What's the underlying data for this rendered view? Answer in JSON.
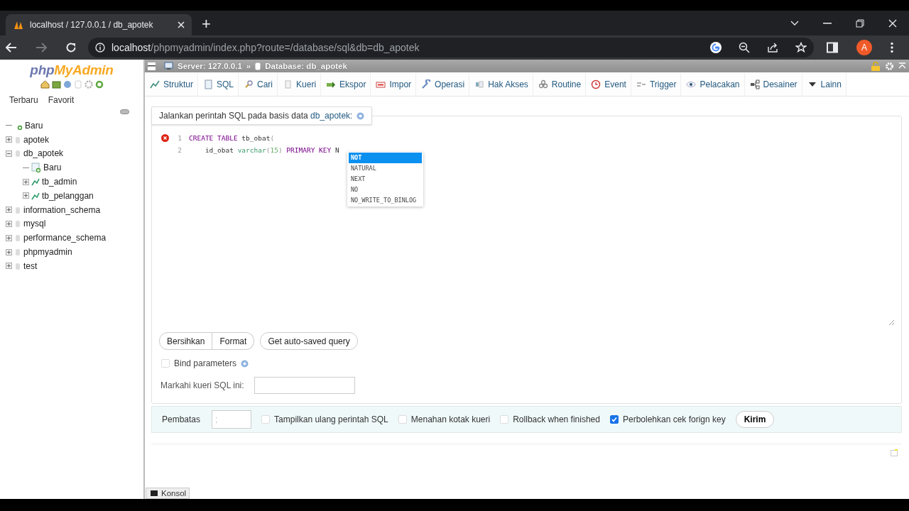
{
  "browser": {
    "tab_title": "localhost / 127.0.0.1 / db_apotek",
    "new_tab": "+",
    "url_host": "localhost",
    "url_path": "/phpmyadmin/index.php?route=/database/sql&db=db_apotek",
    "profile_initial": "A"
  },
  "sidebar": {
    "logo_php": "php",
    "logo_myadmin": "MyAdmin",
    "links": [
      "Terbaru",
      "Favorit"
    ],
    "tree": [
      {
        "label": "Baru",
        "kind": "new"
      },
      {
        "label": "apotek",
        "kind": "database",
        "expanded": false
      },
      {
        "label": "db_apotek",
        "kind": "database",
        "expanded": true,
        "children": [
          {
            "label": "Baru",
            "kind": "new-table"
          },
          {
            "label": "tb_admin",
            "kind": "table",
            "expanded": false
          },
          {
            "label": "tb_pelanggan",
            "kind": "table",
            "expanded": false
          }
        ]
      },
      {
        "label": "information_schema",
        "kind": "database",
        "expanded": false
      },
      {
        "label": "mysql",
        "kind": "database",
        "expanded": false
      },
      {
        "label": "performance_schema",
        "kind": "database",
        "expanded": false
      },
      {
        "label": "phpmyadmin",
        "kind": "database",
        "expanded": false
      },
      {
        "label": "test",
        "kind": "database",
        "expanded": false
      }
    ]
  },
  "breadcrumb": {
    "server": "Server: 127.0.0.1",
    "separator": "»",
    "database": "Database: db_apotek"
  },
  "tabs": [
    {
      "label": "Struktur",
      "selected": false
    },
    {
      "label": "SQL",
      "selected": true
    },
    {
      "label": "Cari",
      "selected": false
    },
    {
      "label": "Kueri",
      "selected": false
    },
    {
      "label": "Ekspor",
      "selected": false
    },
    {
      "label": "Impor",
      "selected": false
    },
    {
      "label": "Operasi",
      "selected": false
    },
    {
      "label": "Hak Akses",
      "selected": false
    },
    {
      "label": "Routine",
      "selected": false
    },
    {
      "label": "Event",
      "selected": false
    },
    {
      "label": "Trigger",
      "selected": false
    },
    {
      "label": "Pelacakan",
      "selected": false
    },
    {
      "label": "Desainer",
      "selected": false
    },
    {
      "label": "Lainn",
      "selected": false
    }
  ],
  "query_box": {
    "legend": "Jalankan perintah SQL pada basis data",
    "legend_link": "db_apotek:",
    "lines": [
      {
        "number": "1",
        "error": true,
        "tokens": [
          {
            "kind": "keyword",
            "text": "CREATE TABLE"
          },
          {
            "kind": "plain",
            "text": " tb_obat"
          },
          {
            "kind": "paren",
            "text": "("
          }
        ]
      },
      {
        "number": "2",
        "error": false,
        "tokens": [
          {
            "kind": "plain",
            "text": "    id_obat "
          },
          {
            "kind": "type",
            "text": "varchar"
          },
          {
            "kind": "paren",
            "text": "("
          },
          {
            "kind": "number",
            "text": "15"
          },
          {
            "kind": "paren",
            "text": ")"
          },
          {
            "kind": "keyword",
            "text": " PRIMARY KEY"
          },
          {
            "kind": "plain",
            "text": " N"
          }
        ]
      }
    ],
    "autocomplete": [
      {
        "label": "NOT",
        "selected": true
      },
      {
        "label": "NATURAL",
        "selected": false
      },
      {
        "label": "NEXT",
        "selected": false
      },
      {
        "label": "NO",
        "selected": false
      },
      {
        "label": "NO_WRITE_TO_BINLOG",
        "selected": false
      }
    ],
    "buttons": [
      "Bersihkan",
      "Format",
      "Get auto-saved query"
    ],
    "bind_parameters": {
      "label": "Bind parameters",
      "checked": false
    },
    "bookmark": {
      "label": "Markahi kueri SQL ini:"
    }
  },
  "options": {
    "delimiter_label": "Pembatas",
    "delimiter_value": ";",
    "checkboxes": [
      {
        "label": "Tampilkan ulang perintah SQL",
        "checked": false
      },
      {
        "label": "Menahan kotak kueri",
        "checked": false
      },
      {
        "label": "Rollback when finished",
        "checked": false
      },
      {
        "label": "Perbolehkan cek forign key",
        "checked": true
      }
    ],
    "submit": "Kirim"
  },
  "console": {
    "label": "Konsol"
  }
}
